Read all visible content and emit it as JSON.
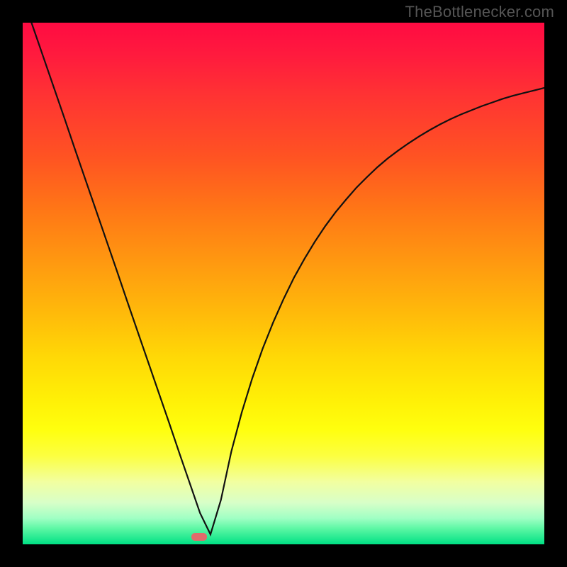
{
  "watermark": "TheBottlenecker.com",
  "marker": {
    "x_frac": 0.338,
    "y_frac": 0.985
  },
  "chart_data": {
    "type": "line",
    "title": "",
    "xlabel": "",
    "ylabel": "",
    "xlim": [
      0,
      1
    ],
    "ylim": [
      0,
      1
    ],
    "grid": false,
    "background_gradient": {
      "direction": "vertical",
      "stops": [
        {
          "pos": 0.0,
          "color": "#ff0b42"
        },
        {
          "pos": 0.5,
          "color": "#ffbb0a"
        },
        {
          "pos": 0.8,
          "color": "#ffff0e"
        },
        {
          "pos": 1.0,
          "color": "#00e084"
        }
      ]
    },
    "series": [
      {
        "name": "bottleneck-curve",
        "x": [
          0.0,
          0.02,
          0.04,
          0.06,
          0.08,
          0.1,
          0.12,
          0.14,
          0.16,
          0.18,
          0.2,
          0.22,
          0.24,
          0.26,
          0.28,
          0.3,
          0.32,
          0.34,
          0.36,
          0.38,
          0.4,
          0.42,
          0.44,
          0.46,
          0.48,
          0.5,
          0.52,
          0.54,
          0.56,
          0.58,
          0.6,
          0.62,
          0.64,
          0.66,
          0.68,
          0.7,
          0.72,
          0.74,
          0.76,
          0.78,
          0.8,
          0.82,
          0.84,
          0.86,
          0.88,
          0.9,
          0.92,
          0.94,
          0.96,
          0.98,
          1.0
        ],
        "y": [
          1.049,
          0.991,
          0.933,
          0.875,
          0.817,
          0.758,
          0.7,
          0.642,
          0.584,
          0.526,
          0.467,
          0.409,
          0.351,
          0.293,
          0.235,
          0.176,
          0.118,
          0.06,
          0.019,
          0.085,
          0.178,
          0.253,
          0.318,
          0.375,
          0.425,
          0.47,
          0.511,
          0.547,
          0.58,
          0.61,
          0.637,
          0.661,
          0.684,
          0.704,
          0.723,
          0.74,
          0.755,
          0.769,
          0.782,
          0.794,
          0.805,
          0.815,
          0.824,
          0.832,
          0.84,
          0.847,
          0.854,
          0.86,
          0.865,
          0.87,
          0.875
        ]
      }
    ],
    "annotations": [
      {
        "type": "marker",
        "shape": "rounded-rect",
        "color": "#e06b6b",
        "x": 0.338,
        "y": 0.015
      }
    ]
  }
}
